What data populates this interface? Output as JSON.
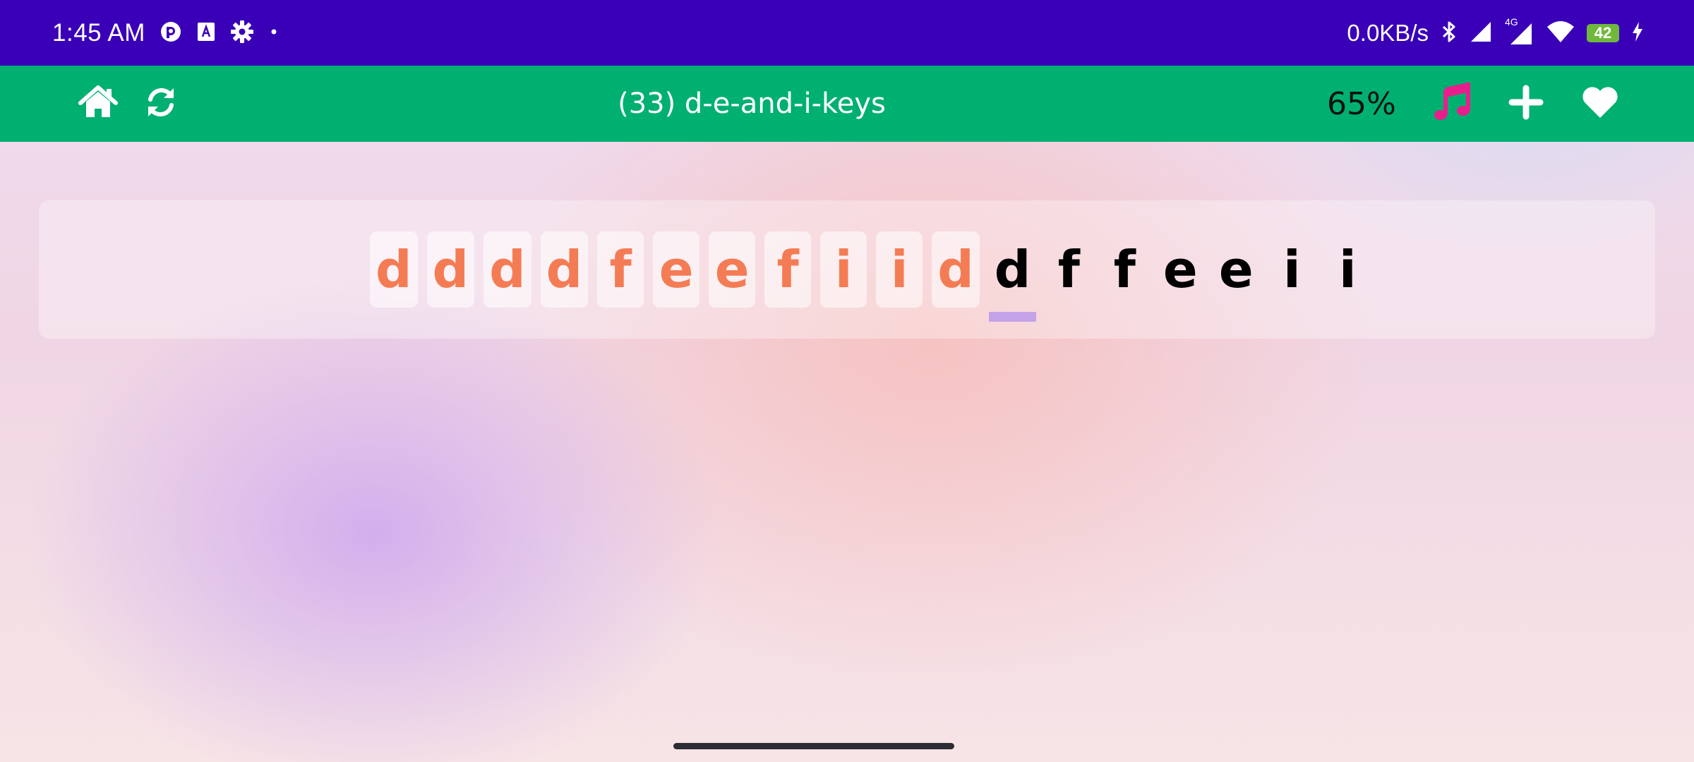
{
  "status_bar": {
    "time": "1:45 AM",
    "net_speed": "0.0KB/s",
    "network_type": "4G",
    "battery_level": "42",
    "icons": [
      "app-notification-icon",
      "font-app-icon",
      "settings-icon",
      "dot-icon",
      "bluetooth-icon",
      "signal-icon",
      "signal-4g-icon",
      "wifi-icon",
      "battery-icon",
      "charging-icon"
    ]
  },
  "toolbar": {
    "title": "(33) d-e-and-i-keys",
    "percent": "65%",
    "colors": {
      "background": "#00b071",
      "music_icon": "#e91e8c"
    },
    "icons": [
      "home-icon",
      "refresh-icon",
      "music-icon",
      "plus-icon",
      "heart-icon"
    ]
  },
  "lesson": {
    "typed": [
      "d",
      "d",
      "d",
      "d",
      "f",
      "e",
      "e",
      "f",
      "i",
      "i",
      "d"
    ],
    "current": "d",
    "remaining": [
      "f",
      "f",
      "e",
      "e",
      "i",
      "i"
    ],
    "colors": {
      "typed": "#f47c54",
      "pending": "#000000",
      "cursor": "#c4a3ea"
    }
  }
}
